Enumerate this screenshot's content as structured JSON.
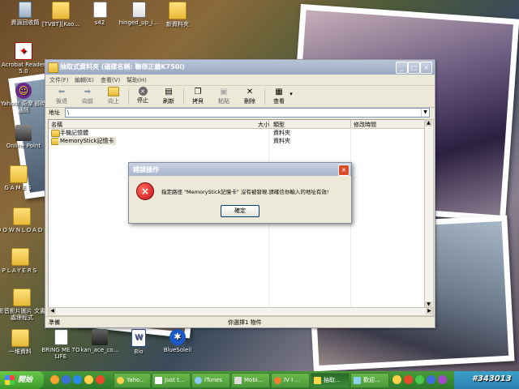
{
  "desktop": {
    "icons": [
      {
        "label": "資源回收筒",
        "kind": "recycle"
      },
      {
        "label": "[TVBT][Kao...",
        "kind": "folder"
      },
      {
        "label": "s42",
        "kind": "file"
      },
      {
        "label": "hinged_up_i...",
        "kind": "file"
      },
      {
        "label": "新資料夾",
        "kind": "folder"
      },
      {
        "label": "Acrobat Reader 5.0",
        "kind": "app"
      },
      {
        "label": "Yahoo! 奇摩 即時通訊",
        "kind": "app"
      },
      {
        "label": "Online Point",
        "kind": "app"
      },
      {
        "label": "GAMES",
        "kind": "folder"
      },
      {
        "label": "DOWNLOADS",
        "kind": "folder"
      },
      {
        "label": "PLAYERS",
        "kind": "folder"
      },
      {
        "label": "影音影片圖片 文書處理程式",
        "kind": "folder"
      },
      {
        "label": "一堆資料",
        "kind": "folder"
      },
      {
        "label": "BRING ME TO LIFE",
        "kind": "file"
      },
      {
        "label": "kan_ace_co...",
        "kind": "file"
      },
      {
        "label": "Bio",
        "kind": "file"
      },
      {
        "label": "BlueSoleil",
        "kind": "app"
      }
    ]
  },
  "window": {
    "title": "抽取式資料夾 (磁碟名稱: 聯想正義K750i)",
    "menu": [
      "文件(F)",
      "編輯(E)",
      "查看(V)",
      "幫助(H)"
    ],
    "toolbar": [
      {
        "label": "後退",
        "icon": "back-arrow-icon"
      },
      {
        "label": "向前",
        "icon": "forward-arrow-icon"
      },
      {
        "label": "向上",
        "icon": "up-folder-icon"
      },
      {
        "label": "停止",
        "icon": "stop-icon"
      },
      {
        "label": "刷新",
        "icon": "refresh-icon"
      },
      {
        "label": "拷貝",
        "icon": "copy-icon"
      },
      {
        "label": "粘貼",
        "icon": "paste-icon"
      },
      {
        "label": "刪除",
        "icon": "delete-icon"
      },
      {
        "label": "查看",
        "icon": "view-icon"
      }
    ],
    "address_label": "地址",
    "address_value": "\\",
    "columns": [
      "名稱",
      "大小",
      "類型",
      "修改時間"
    ],
    "rows": [
      {
        "name": "手機記憶體",
        "size": "",
        "type": "資料夾",
        "modified": ""
      },
      {
        "name": "MemoryStick記憶卡",
        "size": "",
        "type": "資料夾",
        "modified": ""
      }
    ],
    "status_left": "準備",
    "status_mid": "你選擇1 物件"
  },
  "dialog": {
    "title": "錯誤操作",
    "message": "指定路徑 \"MemoryStick記憶卡\" 沒有被發現.請確信你輸入的地址有效!",
    "ok_label": "確定",
    "close": "×"
  },
  "taskbar": {
    "start_label": "開始",
    "buttons": [
      {
        "label": "Yaho...",
        "active": false
      },
      {
        "label": "Just t...",
        "active": false
      },
      {
        "label": "iTunes",
        "active": false
      },
      {
        "label": "Mobi...",
        "active": false
      },
      {
        "label": "IV I ...",
        "active": false
      },
      {
        "label": "抽取...",
        "active": true
      },
      {
        "label": "歡迎...",
        "active": false
      }
    ],
    "watermark": "#343013"
  },
  "colors": {
    "taskbar": "#3a8a3a",
    "titlebar": "#9aa8c2",
    "error_red": "#c8101a"
  }
}
